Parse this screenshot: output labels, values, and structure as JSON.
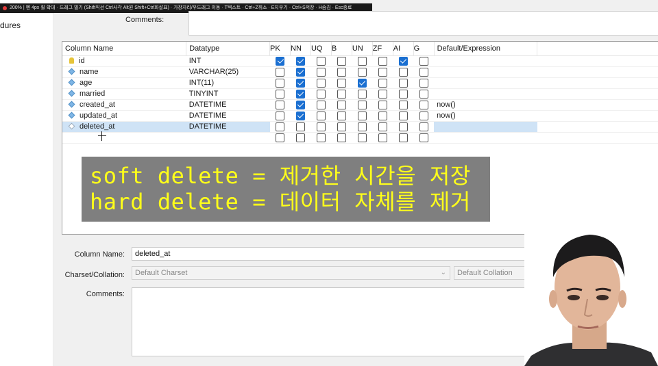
{
  "zoombar": {
    "text": "200%  |  펜 4px   휠 확대 · 드래그 밀기 (Shift직선 Ctrl사각 Alt원 Shift+Ctrl화살표) · 가장자리/우드래그 이동 · T텍스트 · Ctrl+Z취소 · E지우기 · Ctrl+S저장 · H숨김 · Esc종료"
  },
  "sidebar": {
    "item": "dures"
  },
  "comments_top": {
    "label": "Comments:"
  },
  "grid": {
    "headers": [
      "Column Name",
      "Datatype",
      "PK",
      "NN",
      "UQ",
      "B",
      "UN",
      "ZF",
      "AI",
      "G",
      "Default/Expression"
    ],
    "rows": [
      {
        "icon": "key-icon",
        "name": "id",
        "type": "INT",
        "flags": [
          true,
          true,
          false,
          false,
          false,
          false,
          true,
          false
        ],
        "default": ""
      },
      {
        "icon": "diamond-icon",
        "name": "name",
        "type": "VARCHAR(25)",
        "flags": [
          false,
          true,
          false,
          false,
          false,
          false,
          false,
          false
        ],
        "default": ""
      },
      {
        "icon": "diamond-icon",
        "name": "age",
        "type": "INT(11)",
        "flags": [
          false,
          true,
          false,
          false,
          true,
          false,
          false,
          false
        ],
        "default": ""
      },
      {
        "icon": "diamond-icon",
        "name": "married",
        "type": "TINYINT",
        "flags": [
          false,
          true,
          false,
          false,
          false,
          false,
          false,
          false
        ],
        "default": ""
      },
      {
        "icon": "diamond-icon",
        "name": "created_at",
        "type": "DATETIME",
        "flags": [
          false,
          true,
          false,
          false,
          false,
          false,
          false,
          false
        ],
        "default": "now()"
      },
      {
        "icon": "diamond-icon",
        "name": "updated_at",
        "type": "DATETIME",
        "flags": [
          false,
          true,
          false,
          false,
          false,
          false,
          false,
          false
        ],
        "default": "now()"
      },
      {
        "icon": "diamond-outline-icon",
        "name": "deleted_at",
        "type": "DATETIME",
        "flags": [
          false,
          false,
          false,
          false,
          false,
          false,
          false,
          false
        ],
        "default": "",
        "selected": true
      },
      {
        "icon": "",
        "name": "",
        "type": "",
        "flags": [
          false,
          false,
          false,
          false,
          false,
          false,
          false,
          false
        ],
        "default": ""
      }
    ]
  },
  "overlay": {
    "line1": "soft delete = 제거한 시간을 저장",
    "line2": "hard delete = 데이터 자체를 제거"
  },
  "details": {
    "column_name_label": "Column Name:",
    "column_name_value": "deleted_at",
    "charset_label": "Charset/Collation:",
    "charset_value": "Default Charset",
    "collation_value": "Default Collation",
    "comments_label": "Comments:"
  },
  "colors": {
    "checkbox_on": "#1a6fd1",
    "overlay_bg": "#7f7f7f",
    "overlay_text": "#ffff1a",
    "selection": "#cfe3f6"
  }
}
